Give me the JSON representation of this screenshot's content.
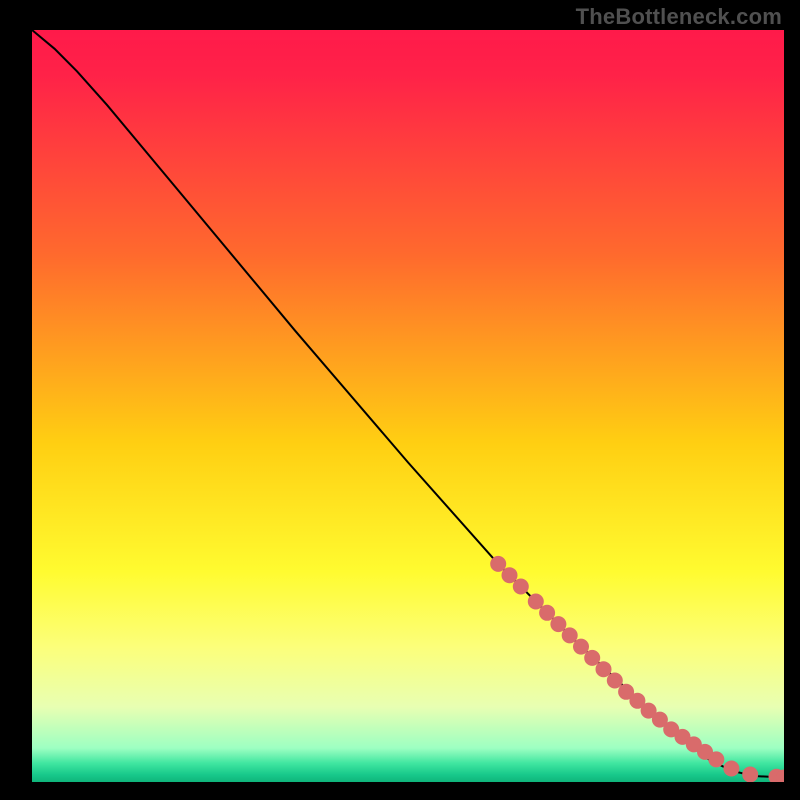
{
  "watermark": "TheBottleneck.com",
  "chart_data": {
    "type": "line",
    "title": "",
    "xlabel": "",
    "ylabel": "",
    "xlim": [
      0,
      100
    ],
    "ylim": [
      0,
      100
    ],
    "background_gradient": {
      "stops": [
        {
          "offset": 0.0,
          "color": "#ff1a4a"
        },
        {
          "offset": 0.06,
          "color": "#ff2248"
        },
        {
          "offset": 0.3,
          "color": "#ff6a2d"
        },
        {
          "offset": 0.55,
          "color": "#ffcf12"
        },
        {
          "offset": 0.72,
          "color": "#fffb30"
        },
        {
          "offset": 0.82,
          "color": "#fcff7a"
        },
        {
          "offset": 0.9,
          "color": "#e8ffb2"
        },
        {
          "offset": 0.955,
          "color": "#9dffc2"
        },
        {
          "offset": 0.975,
          "color": "#40e6a0"
        },
        {
          "offset": 0.99,
          "color": "#18c98b"
        },
        {
          "offset": 1.0,
          "color": "#0fb57b"
        }
      ]
    },
    "series": [
      {
        "name": "curve",
        "type": "line",
        "stroke": "#000000",
        "points": [
          {
            "x": 0.0,
            "y": 100.0
          },
          {
            "x": 3.0,
            "y": 97.5
          },
          {
            "x": 6.0,
            "y": 94.5
          },
          {
            "x": 10.0,
            "y": 90.0
          },
          {
            "x": 20.0,
            "y": 78.0
          },
          {
            "x": 35.0,
            "y": 60.0
          },
          {
            "x": 50.0,
            "y": 42.5
          },
          {
            "x": 62.0,
            "y": 29.0
          },
          {
            "x": 72.0,
            "y": 19.0
          },
          {
            "x": 80.0,
            "y": 11.5
          },
          {
            "x": 86.0,
            "y": 6.0
          },
          {
            "x": 90.0,
            "y": 3.0
          },
          {
            "x": 93.0,
            "y": 1.5
          },
          {
            "x": 96.0,
            "y": 0.8
          },
          {
            "x": 100.0,
            "y": 0.6
          }
        ]
      },
      {
        "name": "markers",
        "type": "scatter",
        "color": "#d96b6b",
        "radius": 8,
        "points": [
          {
            "x": 62.0,
            "y": 29.0
          },
          {
            "x": 63.5,
            "y": 27.5
          },
          {
            "x": 65.0,
            "y": 26.0
          },
          {
            "x": 67.0,
            "y": 24.0
          },
          {
            "x": 68.5,
            "y": 22.5
          },
          {
            "x": 70.0,
            "y": 21.0
          },
          {
            "x": 71.5,
            "y": 19.5
          },
          {
            "x": 73.0,
            "y": 18.0
          },
          {
            "x": 74.5,
            "y": 16.5
          },
          {
            "x": 76.0,
            "y": 15.0
          },
          {
            "x": 77.5,
            "y": 13.5
          },
          {
            "x": 79.0,
            "y": 12.0
          },
          {
            "x": 80.5,
            "y": 10.8
          },
          {
            "x": 82.0,
            "y": 9.5
          },
          {
            "x": 83.5,
            "y": 8.3
          },
          {
            "x": 85.0,
            "y": 7.0
          },
          {
            "x": 86.5,
            "y": 6.0
          },
          {
            "x": 88.0,
            "y": 5.0
          },
          {
            "x": 89.5,
            "y": 4.0
          },
          {
            "x": 91.0,
            "y": 3.0
          },
          {
            "x": 93.0,
            "y": 1.8
          },
          {
            "x": 95.5,
            "y": 1.0
          },
          {
            "x": 99.0,
            "y": 0.7
          },
          {
            "x": 100.0,
            "y": 0.6
          }
        ]
      }
    ]
  }
}
